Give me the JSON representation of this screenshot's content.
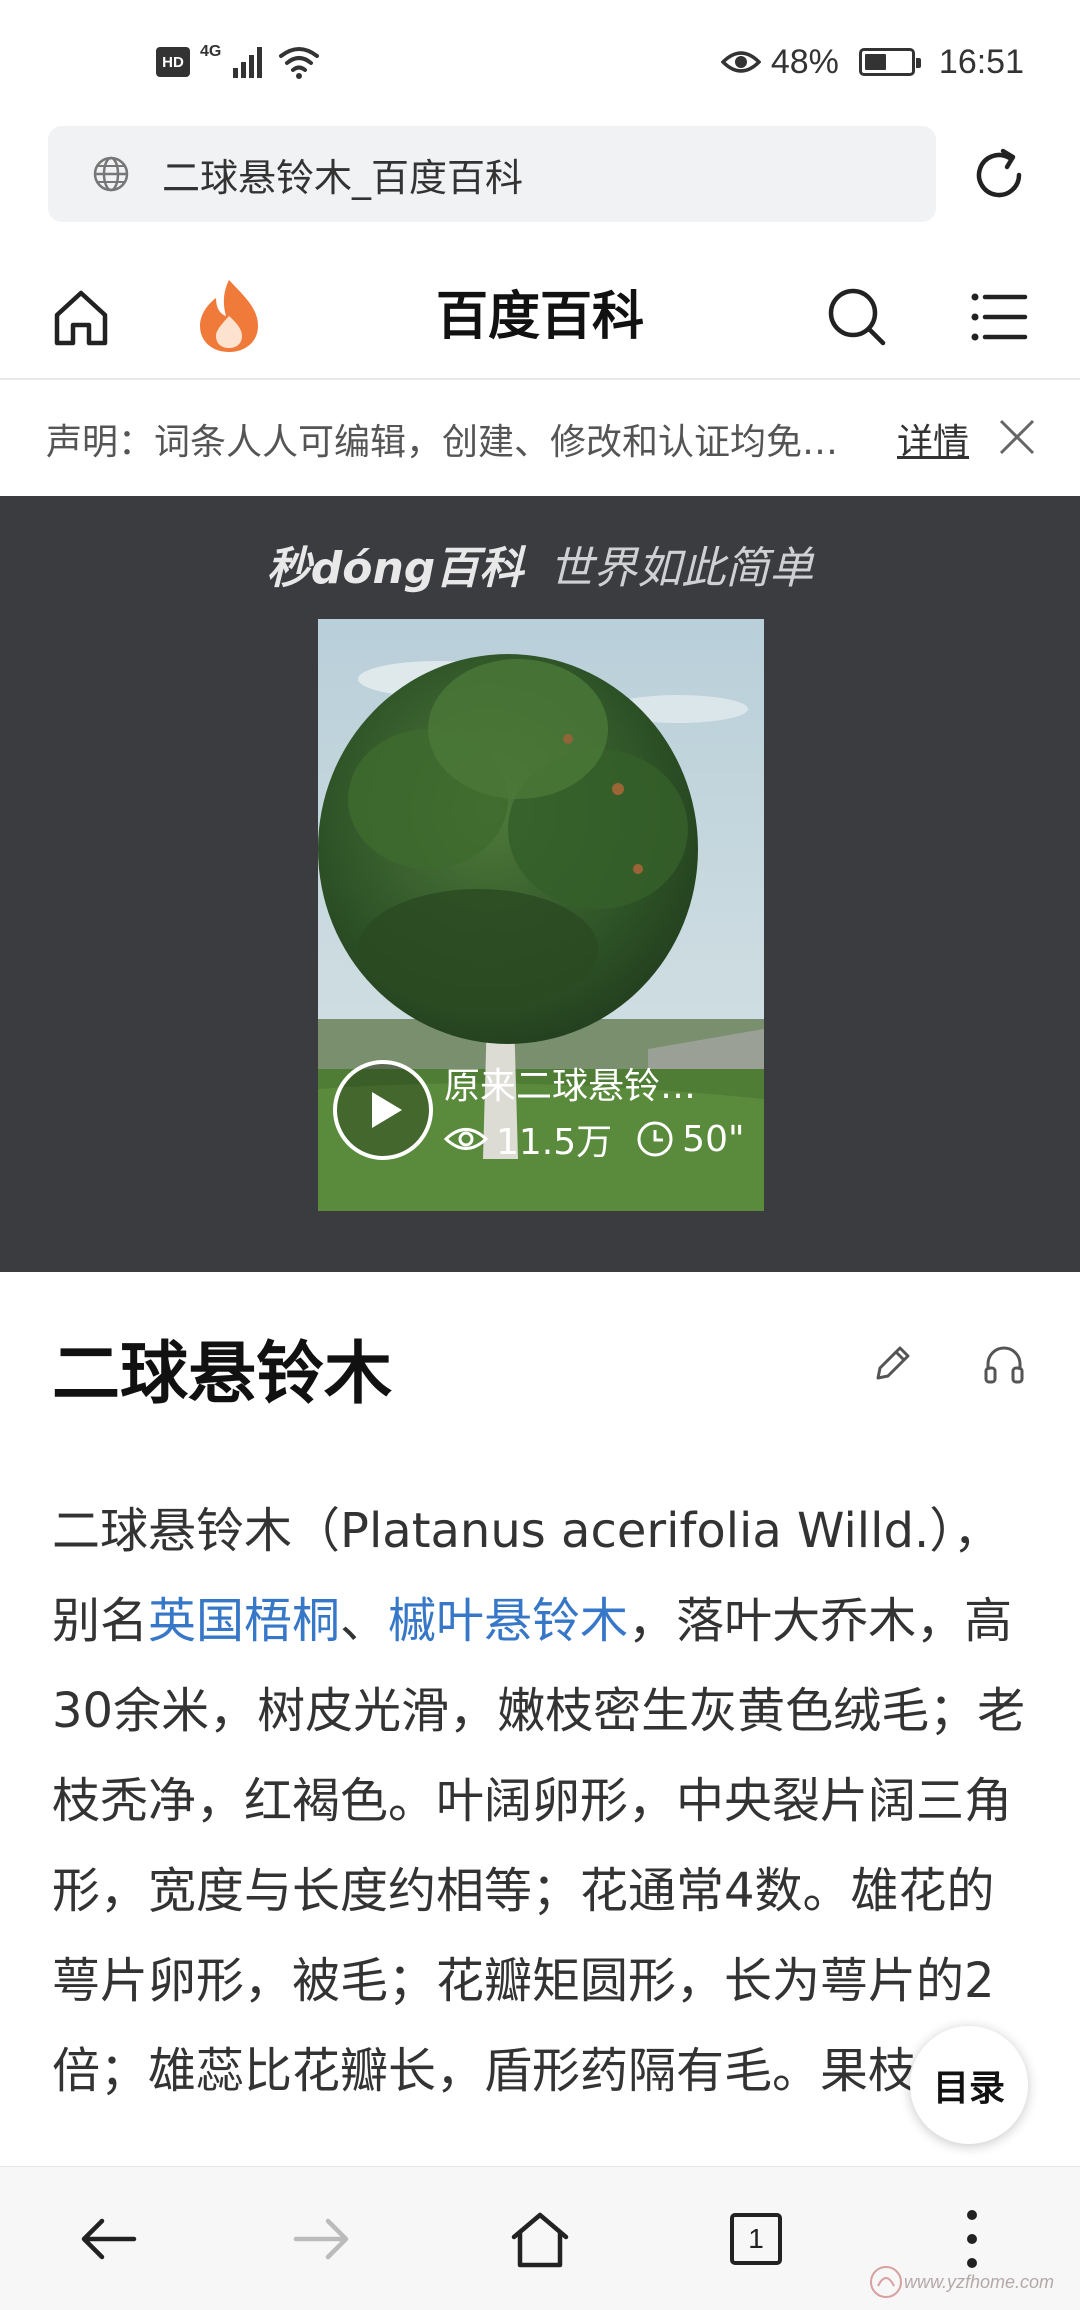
{
  "status_bar": {
    "hd": "HD",
    "network": "4G",
    "battery_percent": "48%",
    "battery_level": 0.48,
    "time": "16:51"
  },
  "url_bar": {
    "text": "二球悬铃木_百度百科"
  },
  "header": {
    "title": "百度百科"
  },
  "notice": {
    "text": "声明：词条人人可编辑，创建、修改和认证均免…",
    "link": "详情"
  },
  "video": {
    "brand": "秒dóng百科",
    "slogan": "世界如此简单",
    "title": "原来二球悬铃…",
    "views": "11.5万",
    "duration": "50\""
  },
  "article": {
    "title": "二球悬铃木",
    "p_start": "二球悬铃木（Platanus acerifolia Willd.），别名",
    "link1": "英国梧桐",
    "sep": "、",
    "link2": "槭叶悬铃木",
    "p_rest": "，落叶大乔木，高30余米，树皮光滑，嫩枝密生灰黄色绒毛；老枝秃净，红褐色。叶阔卵形，中央裂片阔三角形，宽度与长度约相等；花通常4数。雄花的萼片卵形，被毛；花瓣矩圆形，长为萼片的2倍；雄蕊比花瓣长，盾形药隔有毛。果枝"
  },
  "toc": {
    "label": "目录"
  },
  "bottom_bar": {
    "tab_count": "1"
  },
  "watermark": {
    "text": "www.yzfhome.com"
  },
  "colors": {
    "link": "#3777c8",
    "video_bg": "#3a3c40",
    "flame": "#f07a3a"
  }
}
